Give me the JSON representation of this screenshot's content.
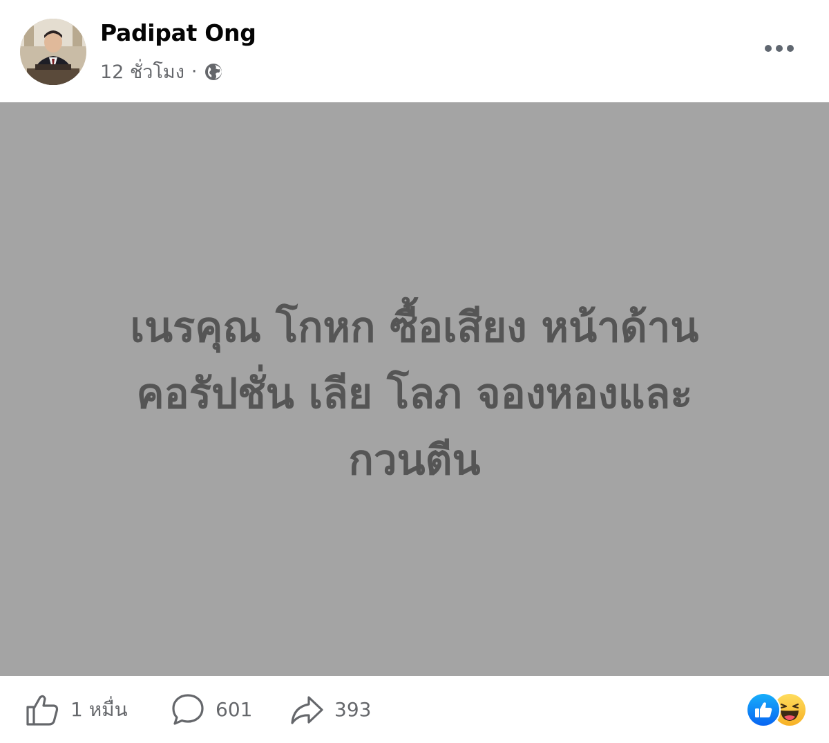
{
  "header": {
    "author_name": "Padipat Ong",
    "timestamp": "12 ชั่วโมง",
    "separator": "·",
    "privacy_icon": "globe-icon",
    "more_icon": "more-options-icon"
  },
  "body": {
    "background_color": "#a4a4a4",
    "text_color": "#555555",
    "line_1": "เนรคุณ โกหก ซื้อเสียง หน้าด้าน",
    "line_2": "คอรัปชั่น เลีย โลภ จองหองและ",
    "line_3": "กวนตีน"
  },
  "footer": {
    "like_count": "1 หมื่น",
    "comment_count": "601",
    "share_count": "393",
    "reaction_icons": [
      "like-reaction-icon",
      "haha-reaction-icon"
    ],
    "like_color": "#1877f2",
    "haha_color": "#f7b125"
  }
}
